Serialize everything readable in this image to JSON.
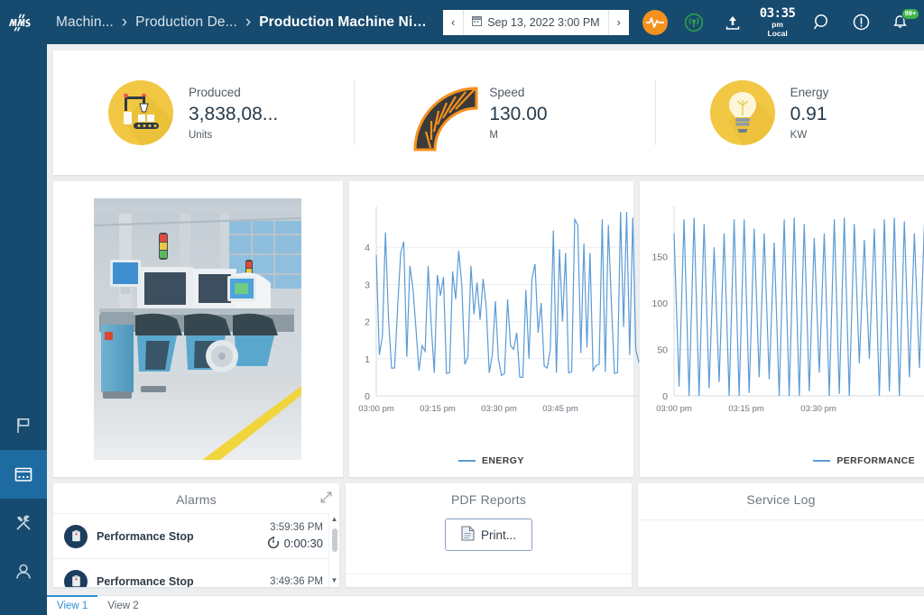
{
  "header": {
    "logo_alt": "mms",
    "breadcrumb": [
      {
        "label": "Machin...",
        "active": false
      },
      {
        "label": "Production De...",
        "active": false
      },
      {
        "label": "Production Machine Niv...",
        "active": true
      }
    ],
    "separator": "›",
    "date_nav": {
      "prev": "‹",
      "next": "›",
      "value": "Sep 13, 2022 3:00 PM",
      "calendar_icon": "calendar-icon"
    },
    "clock": {
      "time": "03:35",
      "ampm": "pm",
      "zone": "Local"
    },
    "notification_badge": "99+",
    "icons": [
      "live-pulse-icon",
      "signal-broadcast-icon",
      "upload-icon",
      "clock-icon",
      "search-icon",
      "alert-icon",
      "notifications-bell-icon",
      "edit-pencil-icon"
    ]
  },
  "sidebar": {
    "items": [
      {
        "name": "flag-icon",
        "label": "Flags",
        "active": false
      },
      {
        "name": "dashboard-icon",
        "label": "Dashboards",
        "active": true
      },
      {
        "name": "tools-icon",
        "label": "Tools",
        "active": false
      },
      {
        "name": "user-icon",
        "label": "User",
        "active": false
      }
    ]
  },
  "kpis": [
    {
      "label": "Produced",
      "value": "3,838,08...",
      "unit": "Units",
      "icon": "robot-conveyor-icon",
      "color": "#f2c744"
    },
    {
      "label": "Speed",
      "value": "130.00",
      "unit": "M",
      "icon": "speed-fan-icon",
      "color": "#f5911e"
    },
    {
      "label": "Energy",
      "value": "0.91",
      "unit": "KW",
      "icon": "lightbulb-icon",
      "color": "#f2c744"
    }
  ],
  "photo_panel": {
    "alt": "Factory floor with SMT pick-and-place machines"
  },
  "chart_data": [
    {
      "type": "line",
      "title": "",
      "legend": "ENERGY",
      "legend_position": "bottom",
      "color": "#5b9bd5",
      "xlabel": "",
      "ylabel": "",
      "ylim": [
        0,
        5
      ],
      "yticks": [
        0,
        1,
        2,
        3,
        4
      ],
      "xticks": [
        "03:00 pm",
        "03:15 pm",
        "03:30 pm",
        "03:45 pm"
      ],
      "grid": true,
      "values": [
        3.8,
        1.1,
        1.6,
        4.4,
        2.1,
        0.75,
        0.75,
        2.4,
        3.85,
        4.15,
        1.05,
        3.5,
        2.9,
        1.8,
        0.68,
        1.35,
        1.2,
        3.5,
        1.9,
        0.62,
        3.25,
        2.7,
        3.2,
        0.6,
        0.62,
        3.35,
        2.6,
        3.9,
        3.0,
        0.85,
        1.05,
        3.5,
        2.2,
        3.05,
        2.05,
        3.15,
        2.4,
        0.62,
        1.1,
        2.55,
        1.0,
        0.55,
        0.6,
        2.6,
        1.35,
        1.25,
        1.7,
        0.5,
        0.5,
        2.85,
        1.0,
        3.15,
        3.55,
        1.7,
        2.5,
        0.8,
        0.75,
        1.25,
        4.45,
        0.62,
        3.95,
        2.0,
        3.85,
        0.62,
        0.65,
        4.75,
        4.6,
        1.15,
        4.1,
        1.3,
        3.85,
        0.68,
        0.82,
        0.85,
        4.75,
        0.65,
        4.6,
        2.5,
        0.6,
        0.62,
        4.95,
        1.85,
        4.95,
        1.1,
        4.8,
        1.25,
        0.9
      ]
    },
    {
      "type": "line",
      "title": "",
      "legend": "PERFORMANCE",
      "legend_position": "bottom",
      "color": "#5b9bd5",
      "xlabel": "",
      "ylabel": "",
      "ylim": [
        0,
        200
      ],
      "yticks": [
        0,
        50,
        100,
        150
      ],
      "xticks": [
        "03:00 pm",
        "03:15 pm",
        "03:30 pm"
      ],
      "grid": true,
      "values": [
        175,
        10,
        190,
        0,
        192,
        0,
        185,
        8,
        160,
        15,
        175,
        0,
        190,
        0,
        190,
        3,
        180,
        20,
        175,
        18,
        165,
        0,
        190,
        0,
        192,
        0,
        185,
        5,
        170,
        25,
        175,
        0,
        190,
        2,
        192,
        0,
        185,
        35,
        168,
        40,
        180,
        0,
        190,
        5,
        192,
        0,
        188,
        20,
        175,
        30,
        185,
        100
      ]
    }
  ],
  "alarms_panel": {
    "title": "Alarms",
    "expand_icon": "expand-icon",
    "rows": [
      {
        "name": "Performance Stop",
        "time": "3:59:36 PM",
        "duration": "0:00:30",
        "icon": "alarm-clipboard-icon"
      },
      {
        "name": "Performance Stop",
        "time": "3:49:36 PM",
        "duration": "",
        "icon": "alarm-clipboard-icon"
      }
    ]
  },
  "pdf_panel": {
    "title": "PDF Reports",
    "print_label": "Print...",
    "print_icon": "document-icon"
  },
  "service_panel": {
    "title": "Service Log"
  },
  "tabs": [
    {
      "label": "View 1",
      "active": true
    },
    {
      "label": "View 2",
      "active": false
    }
  ]
}
